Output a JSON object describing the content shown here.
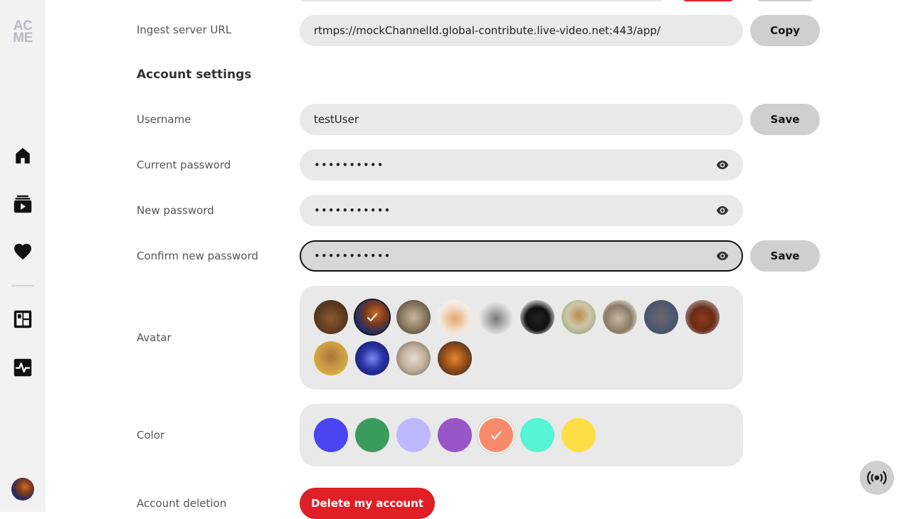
{
  "brand": {
    "logo_text_1": "AC",
    "logo_text_2": "ME"
  },
  "sidebar": {
    "items": [
      {
        "name": "home",
        "icon": "home-icon"
      },
      {
        "name": "videos",
        "icon": "video-library-icon"
      },
      {
        "name": "favorites",
        "icon": "heart-icon"
      },
      {
        "name": "dashboard",
        "icon": "dashboard-icon"
      },
      {
        "name": "activity",
        "icon": "activity-icon"
      }
    ]
  },
  "ingest": {
    "label": "Ingest server URL",
    "value": "rtmps://mockChannelId.global-contribute.live-video.net:443/app/",
    "copy_label": "Copy"
  },
  "account": {
    "title": "Account settings",
    "username": {
      "label": "Username",
      "value": "testUser",
      "save_label": "Save"
    },
    "current_password": {
      "label": "Current password",
      "value": "••••••••••"
    },
    "new_password": {
      "label": "New password",
      "value": "•••••••••••"
    },
    "confirm_password": {
      "label": "Confirm new password",
      "value": "•••••••••••",
      "save_label": "Save"
    },
    "avatar": {
      "label": "Avatar",
      "options": [
        "bear",
        "parrot",
        "owl",
        "shiba",
        "pitbull",
        "pug",
        "giraffe",
        "hedgehog",
        "hippo",
        "horse",
        "antelope",
        "jellyfish",
        "sheep",
        "tiger"
      ],
      "selected": "parrot"
    },
    "color": {
      "label": "Color",
      "options": [
        "#4a44f2",
        "#3a9b5c",
        "#bdb8ff",
        "#9a55c9",
        "#f98b6a",
        "#55f5d6",
        "#fddf45"
      ],
      "selected": "#f98b6a"
    },
    "deletion": {
      "label": "Account deletion",
      "button_label": "Delete my account"
    }
  },
  "colors": {
    "danger": "#e01f26",
    "accent_selected": "#f98b6a"
  }
}
